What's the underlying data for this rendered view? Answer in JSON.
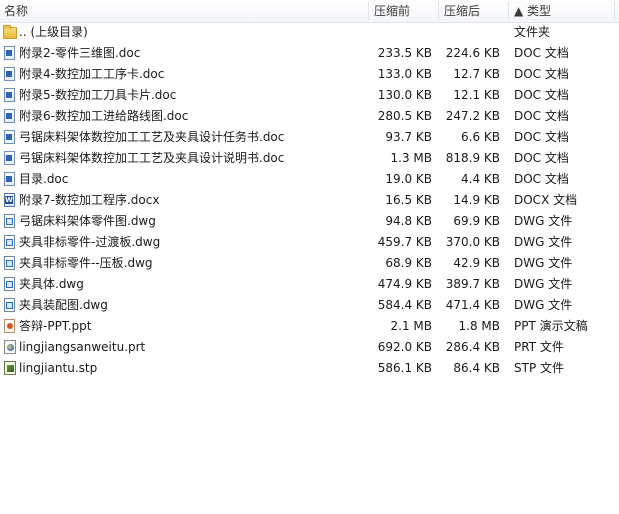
{
  "header": {
    "name": "名称",
    "size": "压缩前",
    "packed": "压缩后",
    "type": "▲ 类型"
  },
  "rows": [
    {
      "icon": "folder",
      "name": ".. (上级目录)",
      "size": "",
      "packed": "",
      "type": "文件夹"
    },
    {
      "icon": "doc",
      "name": "附录2-零件三维图.doc",
      "size": "233.5 KB",
      "packed": "224.6 KB",
      "type": "DOC 文档"
    },
    {
      "icon": "doc",
      "name": "附录4-数控加工工序卡.doc",
      "size": "133.0 KB",
      "packed": "12.7 KB",
      "type": "DOC 文档"
    },
    {
      "icon": "doc",
      "name": "附录5-数控加工刀具卡片.doc",
      "size": "130.0 KB",
      "packed": "12.1 KB",
      "type": "DOC 文档"
    },
    {
      "icon": "doc",
      "name": "附录6-数控加工进给路线图.doc",
      "size": "280.5 KB",
      "packed": "247.2 KB",
      "type": "DOC 文档"
    },
    {
      "icon": "doc",
      "name": "弓锯床料架体数控加工工艺及夹具设计任务书.doc",
      "size": "93.7 KB",
      "packed": "6.6 KB",
      "type": "DOC 文档"
    },
    {
      "icon": "doc",
      "name": "弓锯床料架体数控加工工艺及夹具设计说明书.doc",
      "size": "1.3 MB",
      "packed": "818.9 KB",
      "type": "DOC 文档"
    },
    {
      "icon": "doc",
      "name": "目录.doc",
      "size": "19.0 KB",
      "packed": "4.4 KB",
      "type": "DOC 文档"
    },
    {
      "icon": "docx",
      "name": "附录7-数控加工程序.docx",
      "size": "16.5 KB",
      "packed": "14.9 KB",
      "type": "DOCX 文档"
    },
    {
      "icon": "dwg",
      "name": "弓锯床料架体零件图.dwg",
      "size": "94.8 KB",
      "packed": "69.9 KB",
      "type": "DWG 文件"
    },
    {
      "icon": "dwg",
      "name": "夹具非标零件-过渡板.dwg",
      "size": "459.7 KB",
      "packed": "370.0 KB",
      "type": "DWG 文件"
    },
    {
      "icon": "dwg",
      "name": "夹具非标零件--压板.dwg",
      "size": "68.9 KB",
      "packed": "42.9 KB",
      "type": "DWG 文件"
    },
    {
      "icon": "dwg",
      "name": "夹具体.dwg",
      "size": "474.9 KB",
      "packed": "389.7 KB",
      "type": "DWG 文件"
    },
    {
      "icon": "dwg",
      "name": "夹具装配图.dwg",
      "size": "584.4 KB",
      "packed": "471.4 KB",
      "type": "DWG 文件"
    },
    {
      "icon": "ppt",
      "name": "答辩-PPT.ppt",
      "size": "2.1 MB",
      "packed": "1.8 MB",
      "type": "PPT 演示文稿"
    },
    {
      "icon": "prt",
      "name": "lingjiangsanweitu.prt",
      "size": "692.0 KB",
      "packed": "286.4 KB",
      "type": "PRT 文件"
    },
    {
      "icon": "stp",
      "name": "lingjiantu.stp",
      "size": "586.1 KB",
      "packed": "86.4 KB",
      "type": "STP 文件"
    }
  ]
}
